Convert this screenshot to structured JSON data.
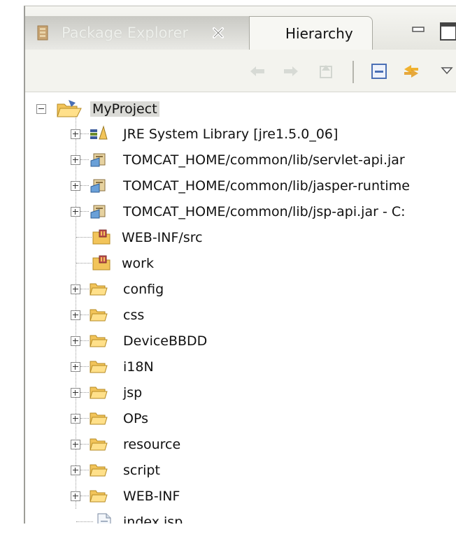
{
  "tabs": {
    "active_label": "Package Explorer",
    "second_label": "Hierarchy"
  },
  "toolbar": {
    "buttons": [
      "back-icon",
      "forward-icon",
      "up-icon",
      "collapse-all-icon",
      "link-with-editor-icon",
      "view-menu-icon"
    ]
  },
  "tree": {
    "root": {
      "label": "MyProject",
      "icon": "java-project-icon",
      "expanded": true
    },
    "items": [
      {
        "label": "JRE System Library [jre1.5.0_06]",
        "icon": "library-icon",
        "expandable": true
      },
      {
        "label": "TOMCAT_HOME/common/lib/servlet-api.jar",
        "icon": "jar-icon",
        "expandable": true
      },
      {
        "label": "TOMCAT_HOME/common/lib/jasper-runtime",
        "icon": "jar-icon",
        "expandable": true
      },
      {
        "label": "TOMCAT_HOME/common/lib/jsp-api.jar - C:",
        "icon": "jar-icon",
        "expandable": true
      },
      {
        "label": "WEB-INF/src",
        "icon": "source-folder-icon",
        "expandable": false
      },
      {
        "label": "work",
        "icon": "source-folder-icon",
        "expandable": false
      },
      {
        "label": "config",
        "icon": "folder-icon",
        "expandable": true
      },
      {
        "label": "css",
        "icon": "folder-icon",
        "expandable": true
      },
      {
        "label": "DeviceBBDD",
        "icon": "folder-icon",
        "expandable": true
      },
      {
        "label": "i18N",
        "icon": "folder-icon",
        "expandable": true
      },
      {
        "label": "jsp",
        "icon": "folder-icon",
        "expandable": true
      },
      {
        "label": "OPs",
        "icon": "folder-icon",
        "expandable": true
      },
      {
        "label": "resource",
        "icon": "folder-icon",
        "expandable": true
      },
      {
        "label": "script",
        "icon": "folder-icon",
        "expandable": true
      },
      {
        "label": "WEB-INF",
        "icon": "folder-icon",
        "expandable": true
      },
      {
        "label": "index.jsp",
        "icon": "file-icon",
        "expandable": false
      }
    ]
  },
  "colors": {
    "folder": "#f2c45a",
    "selection": "#dadad6",
    "tab_active": "#d4d4d0"
  }
}
